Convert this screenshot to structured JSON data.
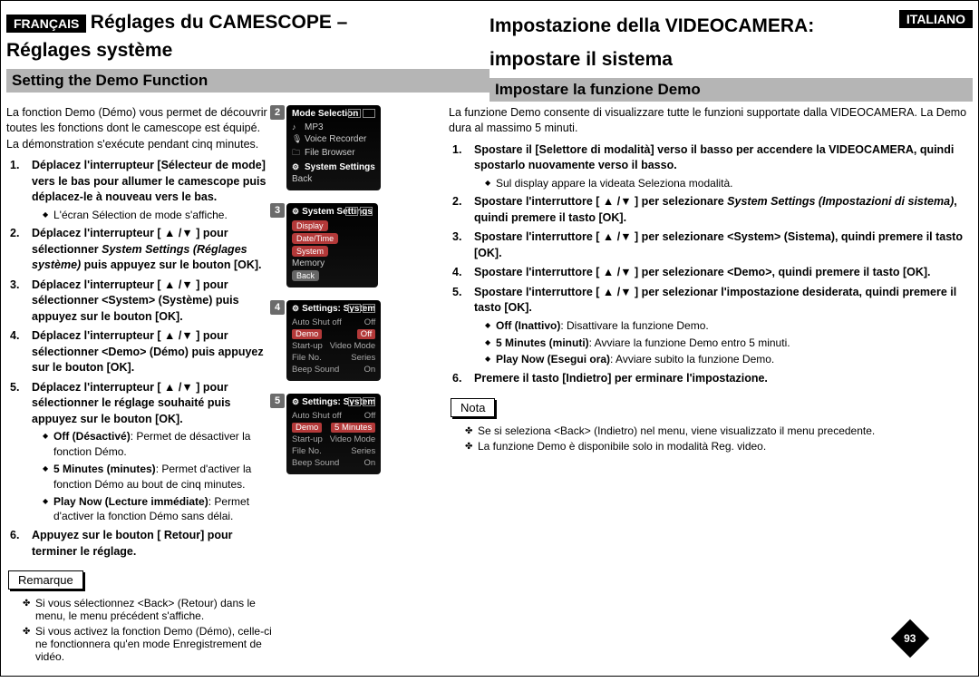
{
  "page_number": "93",
  "left": {
    "lang_badge": "FRANÇAIS",
    "heading_line1": "Réglages du CAMESCOPE –",
    "heading_line2": "Réglages système",
    "section": "Setting the Demo Function",
    "intro": "La fonction Demo (Démo) vous permet de découvrir toutes les fonctions dont le camescope est équipé. La démonstration s'exécute pendant cinq minutes.",
    "steps": [
      {
        "bold": "Déplacez l'interrupteur [Sélecteur de mode] vers le bas pour allumer le camescope puis déplacez-le à nouveau vers le bas.",
        "sub": [
          "L'écran Sélection de mode s'affiche."
        ]
      },
      {
        "pre_bold": "Déplacez l'interrupteur [ ▲ /▼ ] pour sélectionner ",
        "italic": "System Settings (Réglages système)",
        "post_bold": " puis appuyez sur le bouton [OK]."
      },
      {
        "bold": "Déplacez l'interrupteur [ ▲ /▼ ] pour sélectionner <System> (Système) puis appuyez sur le bouton [OK]."
      },
      {
        "bold": "Déplacez l'interrupteur [ ▲ /▼ ] pour sélectionner <Demo> (Démo) puis appuyez sur le bouton [OK]."
      },
      {
        "bold": "Déplacez l'interrupteur [ ▲ /▼ ] pour sélectionner le réglage souhaité puis appuyez sur le bouton [OK].",
        "opts": [
          {
            "b": "Off (Désactivé)",
            "t": ": Permet de désactiver la fonction Démo."
          },
          {
            "b": "5 Minutes (minutes)",
            "t": ": Permet d'activer la fonction Démo au bout de cinq minutes."
          },
          {
            "b": "Play Now (Lecture immédiate)",
            "t": ": Permet d'activer la fonction Démo sans délai."
          }
        ]
      },
      {
        "bold": "Appuyez sur le bouton [ Retour] pour terminer le réglage."
      }
    ],
    "note_label": "Remarque",
    "notes": [
      "Si vous sélectionnez <Back> (Retour) dans le menu, le menu précédent s'affiche.",
      "Si vous activez la fonction Demo (Démo), celle-ci ne fonctionnera qu'en mode Enregistrement de vidéo."
    ]
  },
  "right": {
    "lang_badge": "ITALIANO",
    "heading_line1": "Impostazione della VIDEOCAMERA:",
    "heading_line2": "impostare il sistema",
    "section": "Impostare la funzione Demo",
    "intro": "La funzione Demo consente di visualizzare tutte le funzioni supportate dalla VIDEOCAMERA. La Demo dura al massimo 5 minuti.",
    "steps": [
      {
        "bold": "Spostare il [Selettore di modalità] verso il basso per accendere la VIDEOCAMERA, quindi spostarlo nuovamente verso il basso.",
        "sub": [
          "Sul display appare la videata Seleziona modalità."
        ]
      },
      {
        "pre_bold": "Spostare l'interruttore [ ▲ /▼ ] per selezionare ",
        "italic": "System Settings (Impostazioni di sistema)",
        "post_bold": ", quindi premere il tasto [OK]."
      },
      {
        "bold": "Spostare l'interruttore [ ▲ /▼ ] per selezionare <System> (Sistema), quindi premere il tasto [OK]."
      },
      {
        "bold": "Spostare l'interruttore [ ▲ /▼ ] per selezionare <Demo>, quindi premere il tasto [OK]."
      },
      {
        "bold": "Spostare l'interruttore [ ▲ /▼ ] per selezionar l'impostazione desiderata, quindi premere il tasto [OK].",
        "opts": [
          {
            "b": "Off (Inattivo)",
            "t": ": Disattivare la funzione Demo."
          },
          {
            "b": "5 Minutes (minuti)",
            "t": ": Avviare la funzione Demo entro 5 minuti."
          },
          {
            "b": "Play Now (Esegui ora)",
            "t": ": Avviare subito la funzione Demo."
          }
        ]
      },
      {
        "bold": "Premere il tasto [Indietro] per erminare l'impostazione."
      }
    ],
    "note_label": "Nota",
    "notes": [
      "Se si seleziona <Back> (Indietro) nel menu, viene visualizzato il menu precedente.",
      "La funzione Demo è disponibile solo in modalità Reg. video."
    ]
  },
  "screens": {
    "s2": {
      "title": "Mode Selection",
      "items": [
        "MP3",
        "Voice Recorder",
        "File Browser"
      ],
      "selected": "System Settings",
      "back": "Back"
    },
    "s3": {
      "title": "System Settings",
      "pills": [
        "Display",
        "Date/Time",
        "System"
      ],
      "tail": [
        "Memory",
        "Back"
      ]
    },
    "s4": {
      "title": "Settings: System",
      "rows": [
        {
          "k": "Auto Shut off",
          "v": "Off"
        },
        {
          "k": "Demo",
          "v": "Off",
          "hl": true
        },
        {
          "k": "Start-up",
          "v": "Video Mode"
        },
        {
          "k": "File No.",
          "v": "Series"
        },
        {
          "k": "Beep Sound",
          "v": "On"
        }
      ]
    },
    "s5": {
      "title": "Settings: System",
      "rows": [
        {
          "k": "Auto Shut off",
          "v": "Off"
        },
        {
          "k": "Demo",
          "v": "5 Minutes",
          "hl": true,
          "vhl": true
        },
        {
          "k": "Start-up",
          "v": "Video Mode"
        },
        {
          "k": "File No.",
          "v": "Series"
        },
        {
          "k": "Beep Sound",
          "v": "On"
        }
      ]
    }
  }
}
